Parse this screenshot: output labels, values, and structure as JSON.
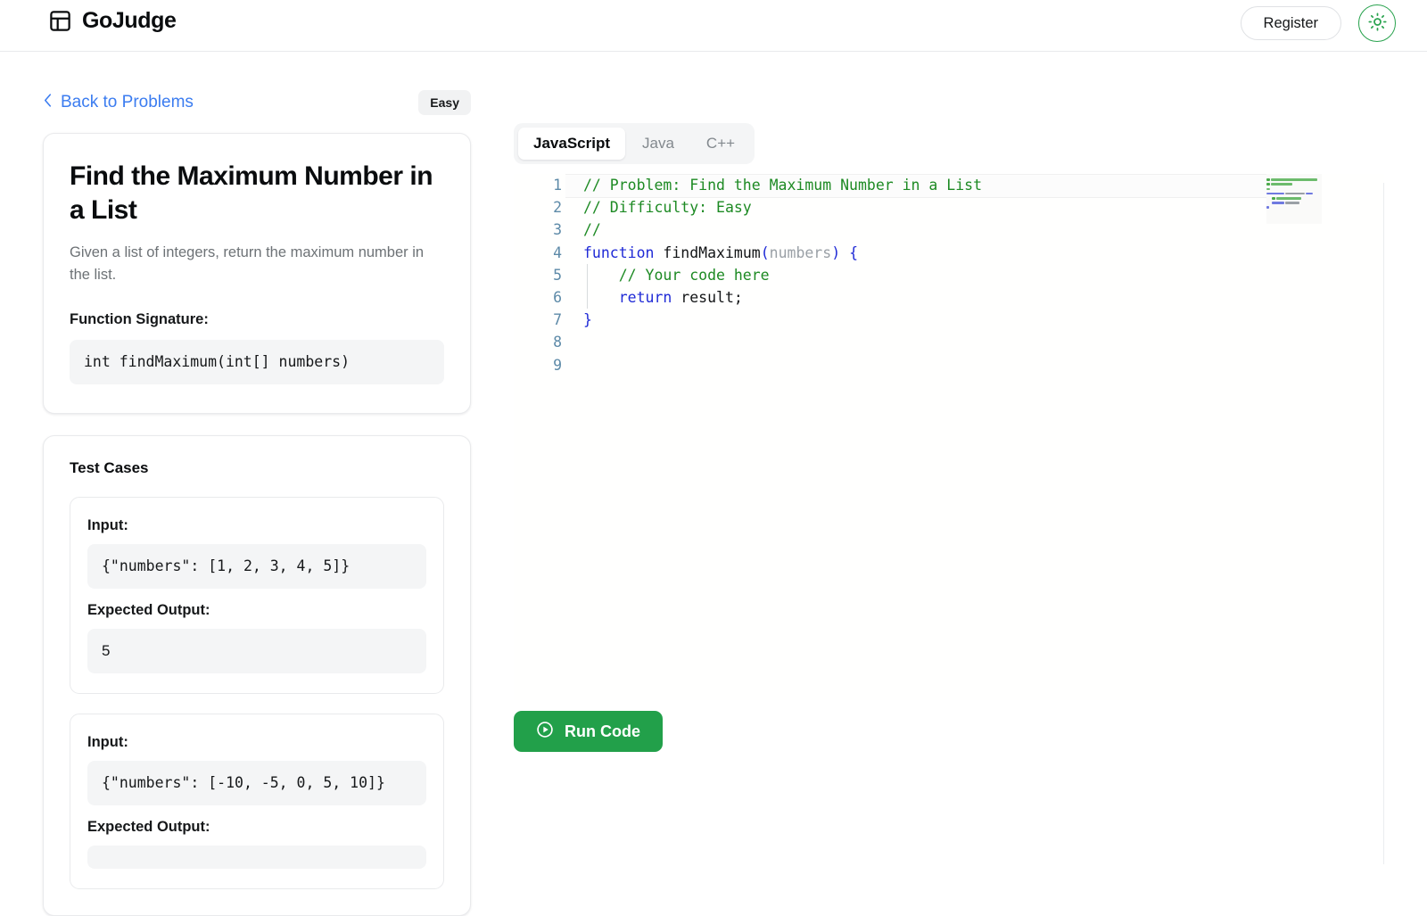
{
  "header": {
    "brand": "GoJudge",
    "logo_icon": "layout-panel-icon",
    "register_label": "Register",
    "theme_icon": "sun-icon",
    "accent_green": "#22a04a",
    "link_blue": "#3b7cf0"
  },
  "breadcrumb": {
    "back_label": "Back to Problems",
    "back_icon": "chevron-left-icon",
    "difficulty": "Easy"
  },
  "problem": {
    "title": "Find the Maximum Number in a List",
    "description": "Given a list of integers, return the maximum number in the list.",
    "signature_label": "Function Signature:",
    "signature": "int findMaximum(int[] numbers)"
  },
  "tests": {
    "title": "Test Cases",
    "input_label": "Input:",
    "expected_label": "Expected Output:",
    "cases": [
      {
        "input": "{\"numbers\": [1, 2, 3, 4, 5]}",
        "expected": "5"
      },
      {
        "input": "{\"numbers\": [-10, -5, 0, 5, 10]}",
        "expected": ""
      }
    ]
  },
  "editor": {
    "tabs": [
      {
        "label": "JavaScript",
        "active": true
      },
      {
        "label": "Java",
        "active": false
      },
      {
        "label": "C++",
        "active": false
      }
    ],
    "line_numbers": [
      "1",
      "2",
      "3",
      "4",
      "5",
      "6",
      "7",
      "8",
      "9"
    ],
    "lines": [
      "// Problem: Find the Maximum Number in a List",
      "// Difficulty: Easy",
      "//",
      "function findMaximum(numbers) {",
      "    // Your code here",
      "    return result;",
      "}",
      "",
      ""
    ],
    "current_line": 1
  },
  "actions": {
    "run_label": "Run Code",
    "run_icon": "play-circle-icon"
  }
}
